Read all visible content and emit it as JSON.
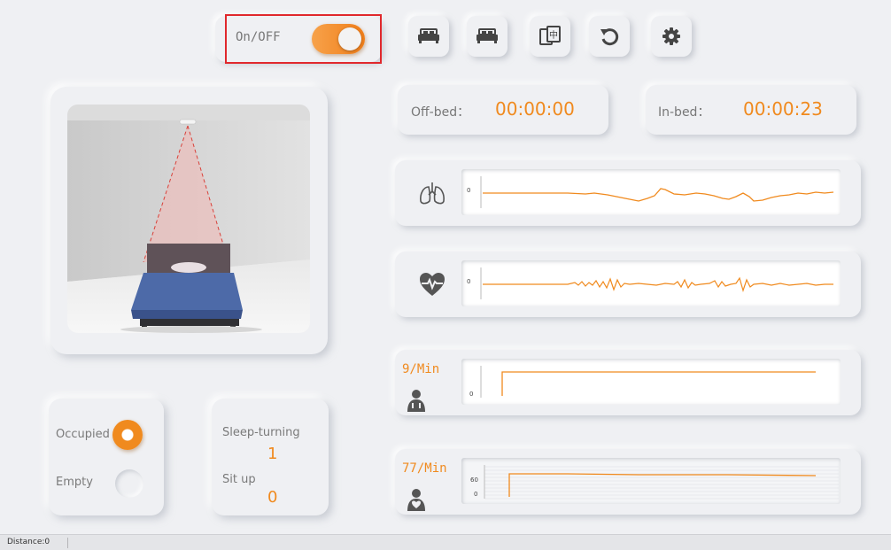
{
  "power": {
    "label": "On/OFF",
    "state": "on"
  },
  "toolbar": {
    "icons": [
      "bed-icon",
      "bed-icon-2",
      "language-icon",
      "refresh-icon",
      "settings-icon"
    ]
  },
  "timers": {
    "off_bed_label": "Off-bed：",
    "off_bed_value": "00:00:00",
    "in_bed_label": "In-bed：",
    "in_bed_value": "00:00:23"
  },
  "charts": {
    "respiration_axis": "0",
    "heartbeat_axis": "0",
    "breath_rate": "9/Min",
    "breath_rate_axis": "0",
    "heart_rate": "77/Min",
    "heart_rate_axis_top": "60",
    "heart_rate_axis_bottom": "0"
  },
  "occupancy": {
    "occupied_label": "Occupied",
    "empty_label": "Empty",
    "selected": "Occupied"
  },
  "activity": {
    "sleep_turning_label": "Sleep-turning",
    "sleep_turning_value": "1",
    "sit_up_label": "Sit up",
    "sit_up_value": "0"
  },
  "status_bar": {
    "distance": "Distance:0"
  },
  "colors": {
    "accent": "#f08a1e",
    "highlight": "#e0282c",
    "background": "#eff0f3"
  }
}
